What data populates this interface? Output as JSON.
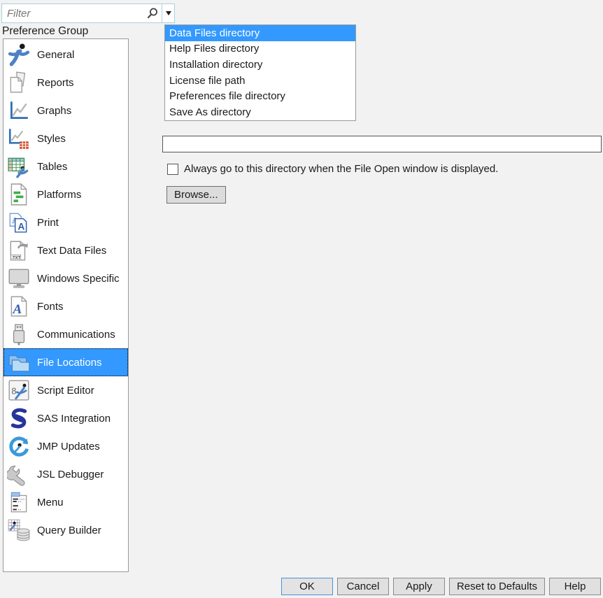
{
  "filter": {
    "placeholder": "Filter"
  },
  "preference_group": {
    "label": "Preference Group",
    "items": [
      {
        "label": "General",
        "icon": "jmp-logo",
        "selected": false
      },
      {
        "label": "Reports",
        "icon": "reports",
        "selected": false
      },
      {
        "label": "Graphs",
        "icon": "graphs",
        "selected": false
      },
      {
        "label": "Styles",
        "icon": "styles",
        "selected": false
      },
      {
        "label": "Tables",
        "icon": "tables",
        "selected": false
      },
      {
        "label": "Platforms",
        "icon": "platforms",
        "selected": false
      },
      {
        "label": "Print",
        "icon": "print",
        "selected": false
      },
      {
        "label": "Text Data Files",
        "icon": "text-data-files",
        "selected": false
      },
      {
        "label": "Windows Specific",
        "icon": "windows-specific",
        "selected": false
      },
      {
        "label": "Fonts",
        "icon": "fonts",
        "selected": false
      },
      {
        "label": "Communications",
        "icon": "communications",
        "selected": false
      },
      {
        "label": "File Locations",
        "icon": "file-locations",
        "selected": true
      },
      {
        "label": "Script Editor",
        "icon": "script-editor",
        "selected": false
      },
      {
        "label": "SAS Integration",
        "icon": "sas-integration",
        "selected": false
      },
      {
        "label": "JMP Updates",
        "icon": "jmp-updates",
        "selected": false
      },
      {
        "label": "JSL Debugger",
        "icon": "jsl-debugger",
        "selected": false
      },
      {
        "label": "Menu",
        "icon": "menu",
        "selected": false
      },
      {
        "label": "Query Builder",
        "icon": "query-builder",
        "selected": false
      }
    ]
  },
  "location_list": {
    "items": [
      "Data Files directory",
      "Help Files directory",
      "Installation directory",
      "License file path",
      "Preferences file directory",
      "Save As directory"
    ],
    "selected_index": 0
  },
  "directory_path_field": {
    "value": ""
  },
  "always_go_checkbox": {
    "label": "Always go to this directory when the File Open window is displayed.",
    "checked": false
  },
  "browse_button": {
    "label": "Browse..."
  },
  "footer": {
    "buttons": [
      {
        "label": "OK",
        "default": true
      },
      {
        "label": "Cancel",
        "default": false
      },
      {
        "label": "Apply",
        "default": false
      },
      {
        "label": "Reset to Defaults",
        "default": false
      },
      {
        "label": "Help",
        "default": false
      }
    ]
  },
  "colors": {
    "selection_blue": "#3399ff",
    "filter_border_blue": "#a6d2e0",
    "default_button_border": "#4a90d9",
    "dialog_background": "#f2f2f2"
  }
}
